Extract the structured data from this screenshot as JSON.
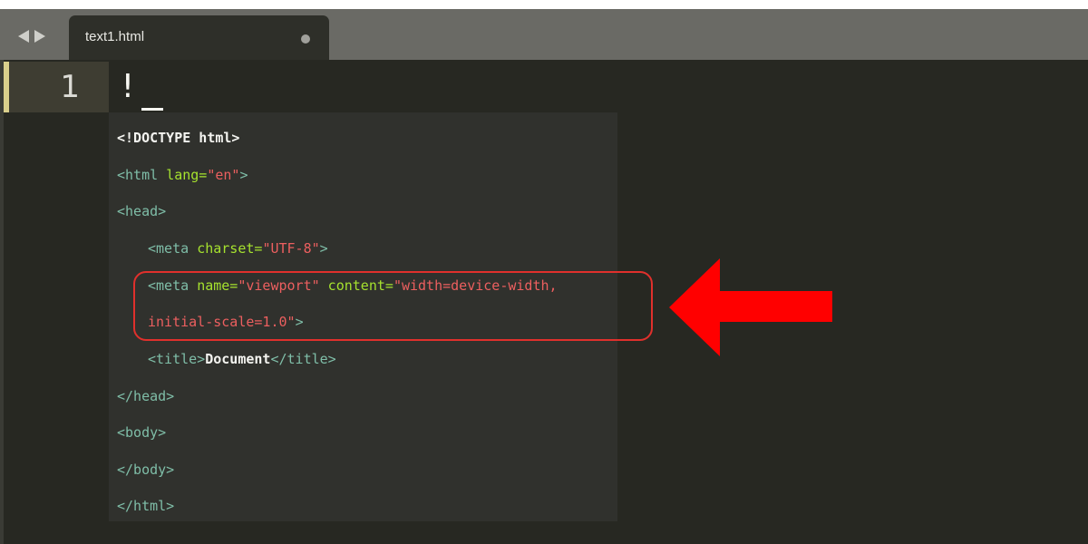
{
  "window": {
    "tab_title": "text1.html",
    "tab_modified_indicator": "●"
  },
  "editor": {
    "line_number": "1",
    "line_text": "!"
  },
  "autocomplete": {
    "lines": [
      {
        "indent": false,
        "tokens": [
          {
            "t": "<!DOCTYPE html>",
            "c": "plain"
          }
        ]
      },
      {
        "indent": false,
        "tokens": [
          {
            "t": "<html ",
            "c": "tag"
          },
          {
            "t": "lang=",
            "c": "attr"
          },
          {
            "t": "\"en\"",
            "c": "val"
          },
          {
            "t": ">",
            "c": "tag"
          }
        ]
      },
      {
        "indent": false,
        "tokens": [
          {
            "t": "<head>",
            "c": "tag"
          }
        ]
      },
      {
        "indent": true,
        "tokens": [
          {
            "t": "<meta ",
            "c": "tag"
          },
          {
            "t": "charset=",
            "c": "attr"
          },
          {
            "t": "\"UTF-8\"",
            "c": "val"
          },
          {
            "t": ">",
            "c": "tag"
          }
        ]
      },
      {
        "indent": true,
        "tokens": [
          {
            "t": "<meta ",
            "c": "tag"
          },
          {
            "t": "name=",
            "c": "attr"
          },
          {
            "t": "\"viewport\"",
            "c": "val"
          },
          {
            "t": " content=",
            "c": "attr"
          },
          {
            "t": "\"width=device-width,",
            "c": "val"
          }
        ]
      },
      {
        "indent": true,
        "tokens": [
          {
            "t": "initial-scale=1.0\"",
            "c": "val"
          },
          {
            "t": ">",
            "c": "tag"
          }
        ]
      },
      {
        "indent": true,
        "tokens": [
          {
            "t": "<title>",
            "c": "tag"
          },
          {
            "t": "Document",
            "c": "plain"
          },
          {
            "t": "</title>",
            "c": "tag"
          }
        ]
      },
      {
        "indent": false,
        "tokens": [
          {
            "t": "</head>",
            "c": "tag"
          }
        ]
      },
      {
        "indent": false,
        "tokens": [
          {
            "t": "<body>",
            "c": "tag"
          }
        ]
      },
      {
        "indent": false,
        "tokens": [
          {
            "t": "</body>",
            "c": "tag"
          }
        ]
      },
      {
        "indent": false,
        "tokens": [
          {
            "t": "</html>",
            "c": "tag"
          }
        ]
      }
    ]
  },
  "annotation": {
    "color": "#ff0000",
    "box_color": "#e0302c"
  },
  "colors": {
    "tag": "#7fbea8",
    "attr": "#a6e22e",
    "value": "#ec5f5f",
    "plain": "#f4f4f0",
    "editor_bg": "#272822"
  }
}
